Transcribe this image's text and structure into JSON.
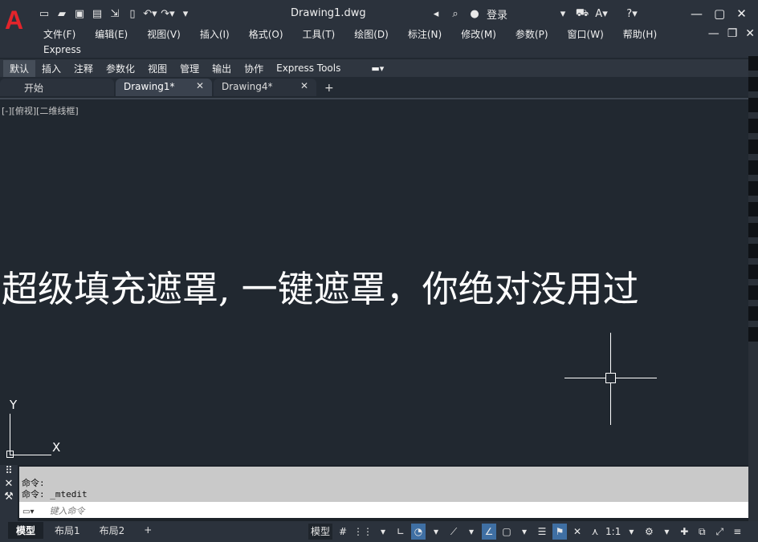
{
  "app": {
    "logo": "A",
    "document_title": "Drawing1.dwg",
    "login_label": "登录"
  },
  "qat_icons": [
    "new-file-icon",
    "open-folder-icon",
    "save-icon",
    "save-as-icon",
    "export-icon",
    "plot-icon",
    "undo-icon",
    "redo-icon",
    "customize-dropdown-icon"
  ],
  "menu": [
    "文件(F)",
    "编辑(E)",
    "视图(V)",
    "插入(I)",
    "格式(O)",
    "工具(T)",
    "绘图(D)",
    "标注(N)",
    "修改(M)",
    "参数(P)",
    "窗口(W)",
    "帮助(H)"
  ],
  "menu_express": "Express",
  "ribbon_tabs": [
    "默认",
    "插入",
    "注释",
    "参数化",
    "视图",
    "管理",
    "输出",
    "协作",
    "Express Tools"
  ],
  "file_tabs": {
    "start": "开始",
    "doc1": "Drawing1*",
    "doc2": "Drawing4*",
    "close": "✕",
    "add": "+"
  },
  "viewport": {
    "label": "[-][俯视][二维线框]",
    "banner": "超级填充遮罩, 一键遮罩，你绝对没用过",
    "ucs_y": "Y",
    "ucs_x": "X"
  },
  "command": {
    "history": [
      "命令:",
      "命令: _mtedit"
    ],
    "placeholder": "键入命令"
  },
  "layout_tabs": [
    "模型",
    "布局1",
    "布局2",
    "+"
  ],
  "status": {
    "model_label": "模型",
    "scale_label": "1:1"
  }
}
